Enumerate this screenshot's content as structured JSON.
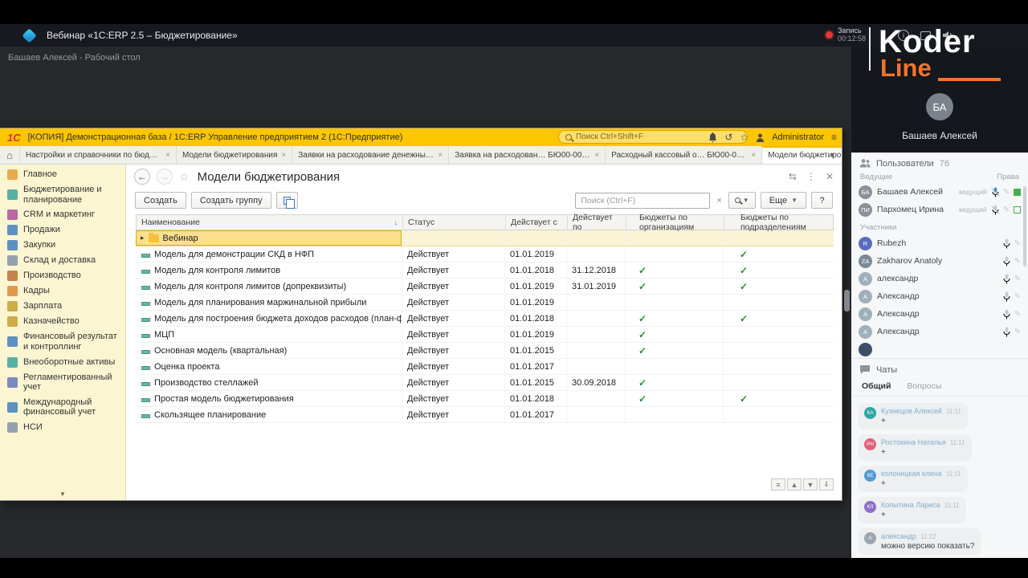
{
  "webinar": {
    "title": "Вебинар «1С:ERP 2.5 – Бюджетирование»",
    "record_label": "Запись",
    "record_time": "00:12:58",
    "caption": "Башаев Алексей - Рабочий стол",
    "logo": {
      "top": "Koder",
      "bottom": "Line"
    },
    "video": {
      "initials": "БА",
      "name": "Башаев Алексей"
    }
  },
  "app": {
    "titlebar": {
      "logo": "1С",
      "title": "[КОПИЯ] Демонстрационная база / 1С:ERP Управление предприятием 2 (1С:Предприятие)",
      "search_placeholder": "Поиск Ctrl+Shift+F",
      "user": "Administrator"
    },
    "tabs": [
      {
        "label": "Настройки и справочники по бюдже…",
        "closable": true,
        "active": false
      },
      {
        "label": "Модели бюджетирования",
        "closable": true,
        "active": false
      },
      {
        "label": "Заявки на расходование денежных …",
        "closable": true,
        "active": false
      },
      {
        "label": "Заявка на расходован…  БЮ00-000001",
        "closable": true,
        "active": false
      },
      {
        "label": "Расходный кассовый о…  БЮ00-000001",
        "closable": true,
        "active": false
      },
      {
        "label": "Модели бюджетирования",
        "closable": true,
        "active": true
      }
    ],
    "sidebar": [
      {
        "label": "Главное",
        "icon": "#e8a33d"
      },
      {
        "label": "Бюджетирование и планирование",
        "icon": "#44a8a0"
      },
      {
        "label": "CRM и маркетинг",
        "icon": "#b2589c"
      },
      {
        "label": "Продажи",
        "icon": "#4d86c0"
      },
      {
        "label": "Закупки",
        "icon": "#4d86c0"
      },
      {
        "label": "Склад и доставка",
        "icon": "#8a99a8"
      },
      {
        "label": "Производство",
        "icon": "#c0763d"
      },
      {
        "label": "Кадры",
        "icon": "#d98f3d"
      },
      {
        "label": "Зарплата",
        "icon": "#c9a43a"
      },
      {
        "label": "Казначейство",
        "icon": "#c9a43a"
      },
      {
        "label": "Финансовый результат и контроллинг",
        "icon": "#4d86c0"
      },
      {
        "label": "Внеоборотные активы",
        "icon": "#44a8a0"
      },
      {
        "label": "Регламентированный учет",
        "icon": "#6a7fc0"
      },
      {
        "label": "Международный финансовый учет",
        "icon": "#4d86c0"
      },
      {
        "label": "НСИ",
        "icon": "#8a99a8"
      }
    ],
    "page": {
      "title": "Модели бюджетирования",
      "buttons": {
        "create": "Создать",
        "create_group": "Создать группу",
        "more": "Еще",
        "help": "?"
      },
      "search_placeholder": "Поиск (Ctrl+F)",
      "table": {
        "columns": [
          "Наименование",
          "Статус",
          "Действует с",
          "Действует по",
          "Бюджеты по организациям",
          "Бюджеты по подразделениям"
        ],
        "rows": [
          {
            "name": "Вебинар",
            "status": "",
            "from": "",
            "to": "",
            "org": false,
            "dep": false,
            "is_folder": true,
            "is_item": false,
            "selected": true
          },
          {
            "name": "Модель для демонстрации СКД в НФП",
            "status": "Действует",
            "from": "01.01.2019",
            "to": "",
            "org": false,
            "dep": true,
            "is_folder": false,
            "is_item": true,
            "selected": false
          },
          {
            "name": "Модель для контроля лимитов",
            "status": "Действует",
            "from": "01.01.2018",
            "to": "31.12.2018",
            "org": true,
            "dep": true,
            "is_folder": false,
            "is_item": true,
            "selected": false
          },
          {
            "name": "Модель для контроля лимитов (допреквизиты)",
            "status": "Действует",
            "from": "01.01.2019",
            "to": "31.01.2019",
            "org": true,
            "dep": true,
            "is_folder": false,
            "is_item": true,
            "selected": false
          },
          {
            "name": "Модель для планирования маржинальной прибыли",
            "status": "Действует",
            "from": "01.01.2019",
            "to": "",
            "org": false,
            "dep": false,
            "is_folder": false,
            "is_item": true,
            "selected": false
          },
          {
            "name": "Модель для построения бюджета доходов расходов (план-факт)",
            "status": "Действует",
            "from": "01.01.2018",
            "to": "",
            "org": true,
            "dep": true,
            "is_folder": false,
            "is_item": true,
            "selected": false
          },
          {
            "name": "МЦП",
            "status": "Действует",
            "from": "01.01.2019",
            "to": "",
            "org": true,
            "dep": false,
            "is_folder": false,
            "is_item": true,
            "selected": false
          },
          {
            "name": "Основная модель (квартальная)",
            "status": "Действует",
            "from": "01.01.2015",
            "to": "",
            "org": true,
            "dep": false,
            "is_folder": false,
            "is_item": true,
            "selected": false
          },
          {
            "name": "Оценка проекта",
            "status": "Действует",
            "from": "01.01.2017",
            "to": "",
            "org": false,
            "dep": false,
            "is_folder": false,
            "is_item": true,
            "selected": false
          },
          {
            "name": "Производство стеллажей",
            "status": "Действует",
            "from": "01.01.2015",
            "to": "30.09.2018",
            "org": true,
            "dep": false,
            "is_folder": false,
            "is_item": true,
            "selected": false
          },
          {
            "name": "Простая модель бюджетирования",
            "status": "Действует",
            "from": "01.01.2018",
            "to": "",
            "org": true,
            "dep": true,
            "is_folder": false,
            "is_item": true,
            "selected": false
          },
          {
            "name": "Скользящее планирование",
            "status": "Действует",
            "from": "01.01.2017",
            "to": "",
            "org": false,
            "dep": false,
            "is_folder": false,
            "is_item": true,
            "selected": false
          }
        ]
      }
    }
  },
  "panel": {
    "users_title": "Пользователи",
    "users_count": "76",
    "hosts_label": "Ведущие",
    "rights_label": "Права",
    "hosts": [
      {
        "initials": "БА",
        "name": "Башаев Алексей",
        "role": "ведущий",
        "mic_on": true,
        "color": "#8a9199"
      },
      {
        "initials": "ПИ",
        "name": "Пархомец Ирина",
        "role": "ведущий",
        "mic_on": false,
        "color": "#8a9199"
      }
    ],
    "participants_label": "Участники",
    "participants": [
      {
        "initials": "R",
        "name": "Rubezh",
        "color": "#5b6cc0"
      },
      {
        "initials": "ZA",
        "name": "Zakharov Anatoly",
        "color": "#7d8b98"
      },
      {
        "initials": "A",
        "name": "александр",
        "color": "#9fb0bd"
      },
      {
        "initials": "A",
        "name": "Александр",
        "color": "#9fb0bd"
      },
      {
        "initials": "A",
        "name": "Александр",
        "color": "#9fb0bd"
      },
      {
        "initials": "A",
        "name": "Александр",
        "color": "#9fb0bd"
      },
      {
        "initials": "",
        "name": "",
        "color": "#3d4f68"
      }
    ],
    "chats_title": "Чаты",
    "chat_tabs": [
      "Общий",
      "Вопросы"
    ],
    "messages": [
      {
        "initials": "КА",
        "name": "Кузнецов Алексей",
        "time": "11:11",
        "text": "+",
        "color": "#2fa8a0"
      },
      {
        "initials": "РН",
        "name": "Ростокина Наталья",
        "time": "11:11",
        "text": "+",
        "color": "#e0607a"
      },
      {
        "initials": "КЕ",
        "name": "колоницкая елена",
        "time": "11:11",
        "text": "+",
        "color": "#4f9bd6"
      },
      {
        "initials": "КЛ",
        "name": "Копытина Лариса",
        "time": "11:11",
        "text": "+",
        "color": "#8e6fc8"
      },
      {
        "initials": "А",
        "name": "александр",
        "time": "11:12",
        "text": "можно версию показать?",
        "color": "#9aa6b0"
      }
    ]
  }
}
